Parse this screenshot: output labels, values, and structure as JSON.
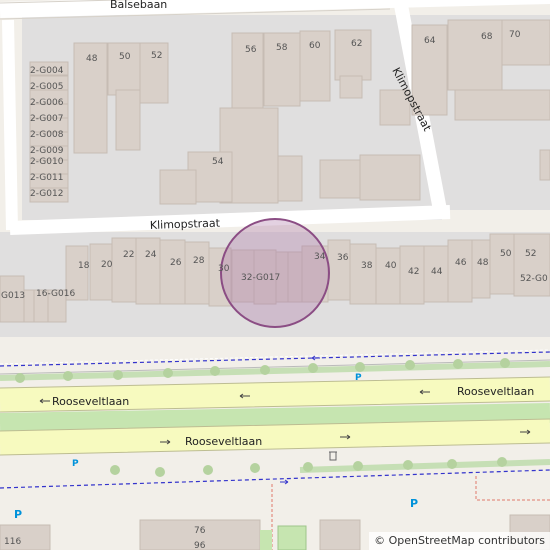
{
  "map": {
    "streets": {
      "balsebaan": "Balsebaan",
      "klimopstraat_h": "Klimopstraat",
      "klimopstraat_v": "Klimopstraat",
      "roosevelt_north": "Rooseveltlaan",
      "roosevelt_east": "Rooseveltlaan",
      "roosevelt_south": "Rooseveltlaan"
    },
    "house_numbers": {
      "n48": "48",
      "n50": "50",
      "n52": "52",
      "n56": "56",
      "n58": "58",
      "n60": "60",
      "n62": "62",
      "n64": "64",
      "n68": "68",
      "n70": "70",
      "n54": "54",
      "g004": "2-G004",
      "g005": "2-G005",
      "g006": "2-G006",
      "g007": "2-G007",
      "g008": "2-G008",
      "g009": "2-G009",
      "g010": "2-G010",
      "g011": "2-G011",
      "g012": "2-G012",
      "r18": "18",
      "r20": "20",
      "r22": "22",
      "r24": "24",
      "r26": "26",
      "r28": "28",
      "r30": "30",
      "r32": "32-G017",
      "r34": "34",
      "r36": "36",
      "r38": "38",
      "r40": "40",
      "r42": "42",
      "r44": "44",
      "r46": "46",
      "r48": "48",
      "r50": "50",
      "r52": "52",
      "r52g": "52-G0",
      "g013": "G013",
      "g016": "16-G016",
      "b76": "76",
      "b96": "96",
      "b116": "116"
    },
    "parking_label": "P",
    "attribution": "© OpenStreetMap contributors"
  }
}
